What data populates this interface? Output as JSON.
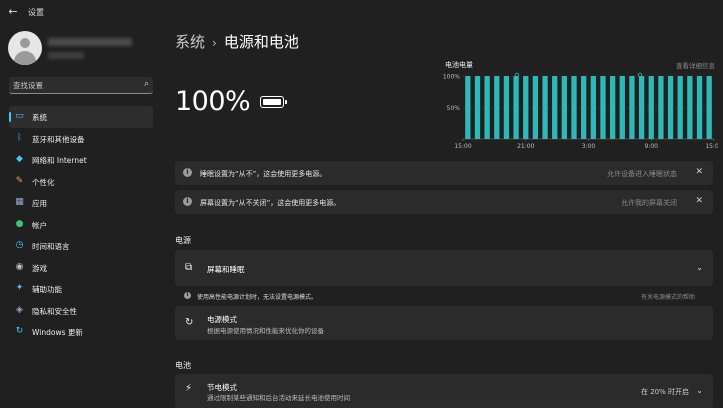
{
  "app": {
    "title": "设置"
  },
  "search": {
    "placeholder": "查找设置"
  },
  "sidebar": {
    "items": [
      {
        "label": "系统",
        "icon": "monitor-icon",
        "active": true,
        "color": "#4cc2ff"
      },
      {
        "label": "蓝牙和其他设备",
        "icon": "bluetooth-icon",
        "color": "#3a96dd"
      },
      {
        "label": "网络和 Internet",
        "icon": "wifi-icon",
        "color": "#4cc2ff"
      },
      {
        "label": "个性化",
        "icon": "brush-icon",
        "color": "#e8a25b"
      },
      {
        "label": "应用",
        "icon": "apps-icon",
        "color": "#9aa8c8"
      },
      {
        "label": "帐户",
        "icon": "person-icon",
        "color": "#3ec47b"
      },
      {
        "label": "时间和语言",
        "icon": "globe-clock-icon",
        "color": "#4cc2ff"
      },
      {
        "label": "游戏",
        "icon": "gamepad-icon",
        "color": "#c0c0c0"
      },
      {
        "label": "辅助功能",
        "icon": "accessibility-icon",
        "color": "#4cc2ff"
      },
      {
        "label": "隐私和安全性",
        "icon": "shield-icon",
        "color": "#9aa8c8"
      },
      {
        "label": "Windows 更新",
        "icon": "update-icon",
        "color": "#4cc2ff"
      }
    ]
  },
  "header": {
    "section": "系统",
    "page": "电源和电池"
  },
  "battery": {
    "percent_text": "100%",
    "level": 1.0
  },
  "chart_data": {
    "type": "bar",
    "title": "电池电量",
    "link": "查看详细信息",
    "y_ticks": [
      "100%",
      "50%"
    ],
    "x_ticks": [
      "15:00",
      "21:00",
      "3:00",
      "9:00",
      "15:00"
    ],
    "ylim": [
      0,
      100
    ],
    "values": [
      100,
      100,
      100,
      100,
      100,
      100,
      100,
      100,
      100,
      100,
      100,
      100,
      100,
      100,
      100,
      100,
      100,
      100,
      100,
      100,
      100,
      100,
      100,
      100,
      100,
      100
    ],
    "bar_color": "#2fb8b8"
  },
  "notices": [
    {
      "text": "睡眠设置为“从不”，这会使用更多电源。",
      "action": "允许设备进入睡眠状态"
    },
    {
      "text": "屏幕设置为“从不关闭”，这会使用更多电源。",
      "action": "允许我的屏幕关闭"
    }
  ],
  "power": {
    "heading": "电源",
    "screen_sleep": {
      "title": "屏幕和睡眠"
    },
    "note": {
      "text": "使用高性能电源计划时，无法设置电源模式。",
      "action": "有关电源模式的帮助"
    },
    "power_mode": {
      "title": "电源模式",
      "subtitle": "根据电源使用情况和性能来优化你的设备"
    }
  },
  "battery_section": {
    "heading": "电池",
    "saver": {
      "title": "节电模式",
      "subtitle": "通过限制某些通知和后台活动来延长电池使用时间",
      "value": "在 20% 时开启"
    }
  }
}
